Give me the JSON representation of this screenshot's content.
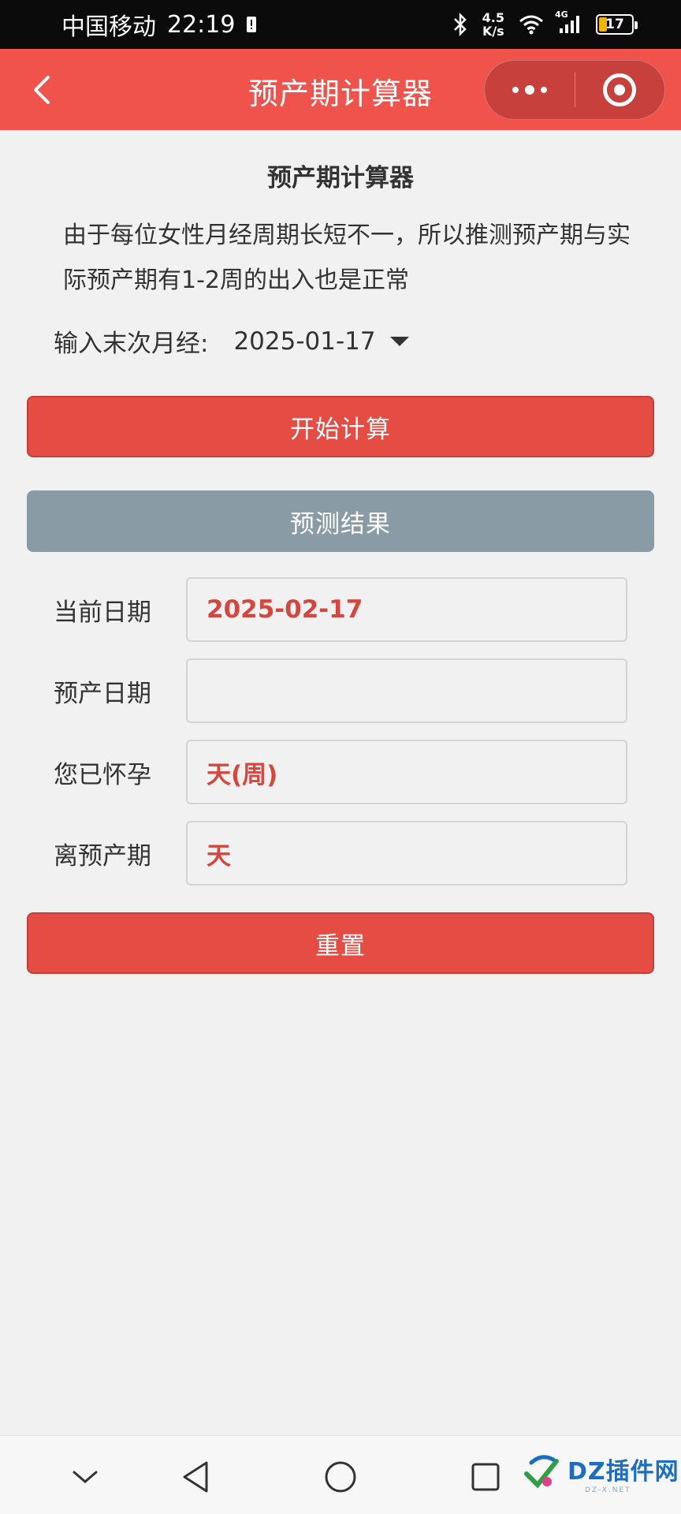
{
  "status_bar": {
    "carrier": "中国移动",
    "time": "22:19",
    "net_speed_value": "4.5",
    "net_speed_unit": "K/s",
    "network_type": "4G",
    "battery": "17",
    "icons": [
      "sim-alert-icon",
      "bluetooth-icon",
      "wifi-icon",
      "signal-icon",
      "battery-icon"
    ]
  },
  "nav": {
    "title": "预产期计算器",
    "color": "#f0524c"
  },
  "main": {
    "heading": "预产期计算器",
    "intro": "由于每位女性月经周期长短不一，所以推测预产期与实际预产期有1-2周的出入也是正常",
    "last_period_label": "输入末次月经:",
    "last_period_value": "2025-01-17",
    "start_button": "开始计算",
    "result_header": "预测结果",
    "fields": [
      {
        "label": "当前日期",
        "value": "2025-02-17"
      },
      {
        "label": "预产日期",
        "value": ""
      },
      {
        "label": "您已怀孕",
        "value": "天(周)"
      },
      {
        "label": "离预产期",
        "value": "天"
      }
    ],
    "reset_button": "重置",
    "accent_color": "#e54d44",
    "value_color": "#d5473e"
  },
  "bottom_nav": {
    "icons": [
      "chevron-down-icon",
      "back-triangle-icon",
      "home-circle-icon",
      "recent-square-icon"
    ],
    "watermark_text": "DZ插件网",
    "watermark_sub": "DZ-X.NET"
  }
}
